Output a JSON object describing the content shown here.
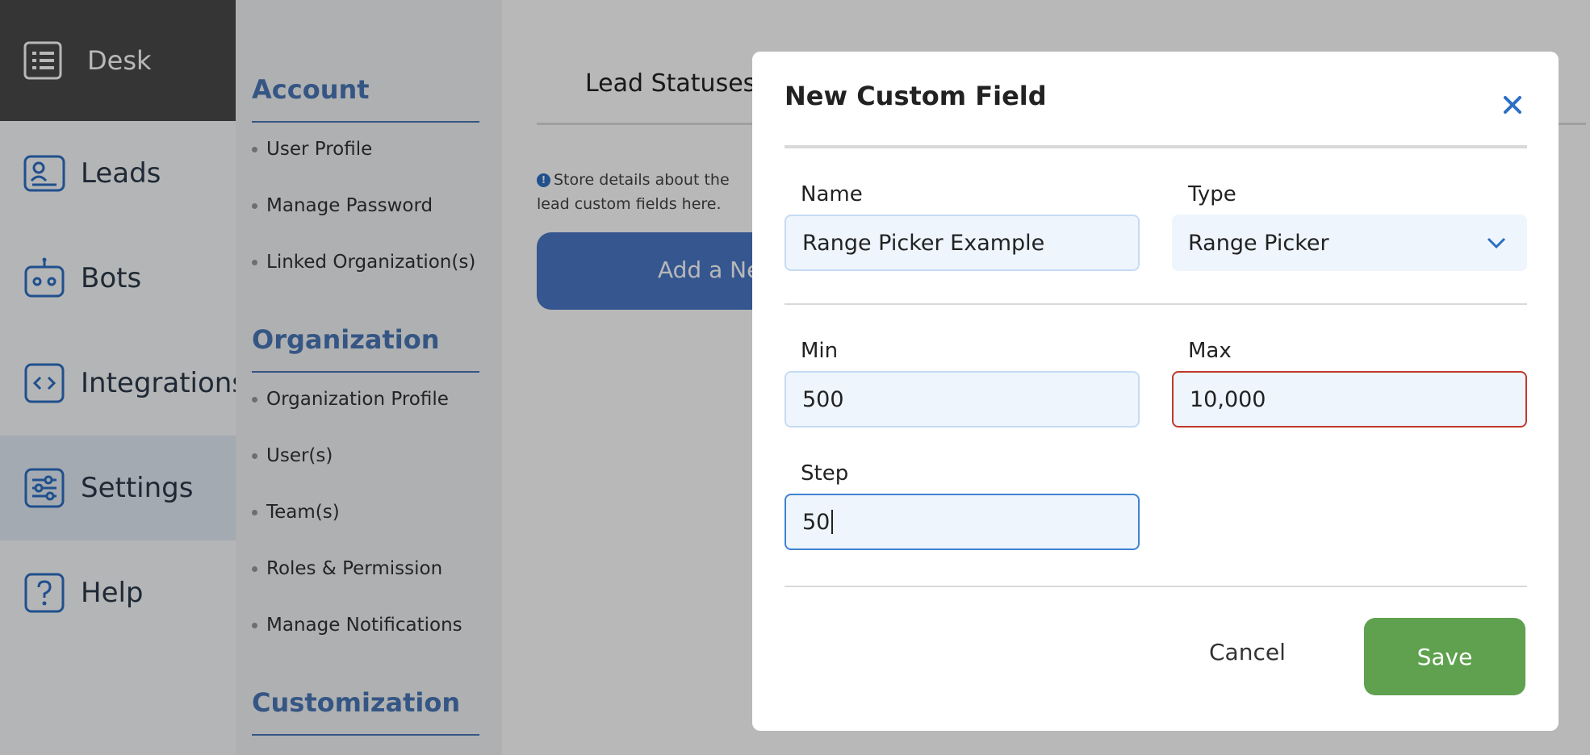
{
  "nav": {
    "top": {
      "label": "Desk",
      "icon": "list-icon"
    },
    "items": [
      {
        "label": "Leads",
        "icon": "contact-card-icon"
      },
      {
        "label": "Bots",
        "icon": "robot-icon"
      },
      {
        "label": "Integrations",
        "icon": "code-icon"
      },
      {
        "label": "Settings",
        "icon": "sliders-icon",
        "active": true
      },
      {
        "label": "Help",
        "icon": "question-icon"
      }
    ]
  },
  "settings_menu": {
    "sections": [
      {
        "title": "Account",
        "items": [
          "User Profile",
          "Manage Password",
          "Linked Organization(s)"
        ]
      },
      {
        "title": "Organization",
        "items": [
          "Organization Profile",
          "User(s)",
          "Team(s)",
          "Roles & Permission",
          "Manage Notifications"
        ]
      },
      {
        "title": "Customization",
        "items": []
      }
    ]
  },
  "main": {
    "tab": "Lead Statuses",
    "info_text": "Store details about the lead custom fields here.",
    "add_button": "Add a Ne"
  },
  "modal": {
    "title": "New Custom Field",
    "name_label": "Name",
    "name_value": "Range Picker Example",
    "type_label": "Type",
    "type_value": "Range Picker",
    "min_label": "Min",
    "min_value": "500",
    "max_label": "Max",
    "max_value": "10,000",
    "step_label": "Step",
    "step_value": "50",
    "cancel_label": "Cancel",
    "save_label": "Save"
  },
  "colors": {
    "accent": "#4a78b8",
    "save": "#5fa14e",
    "error": "#c0392b"
  }
}
